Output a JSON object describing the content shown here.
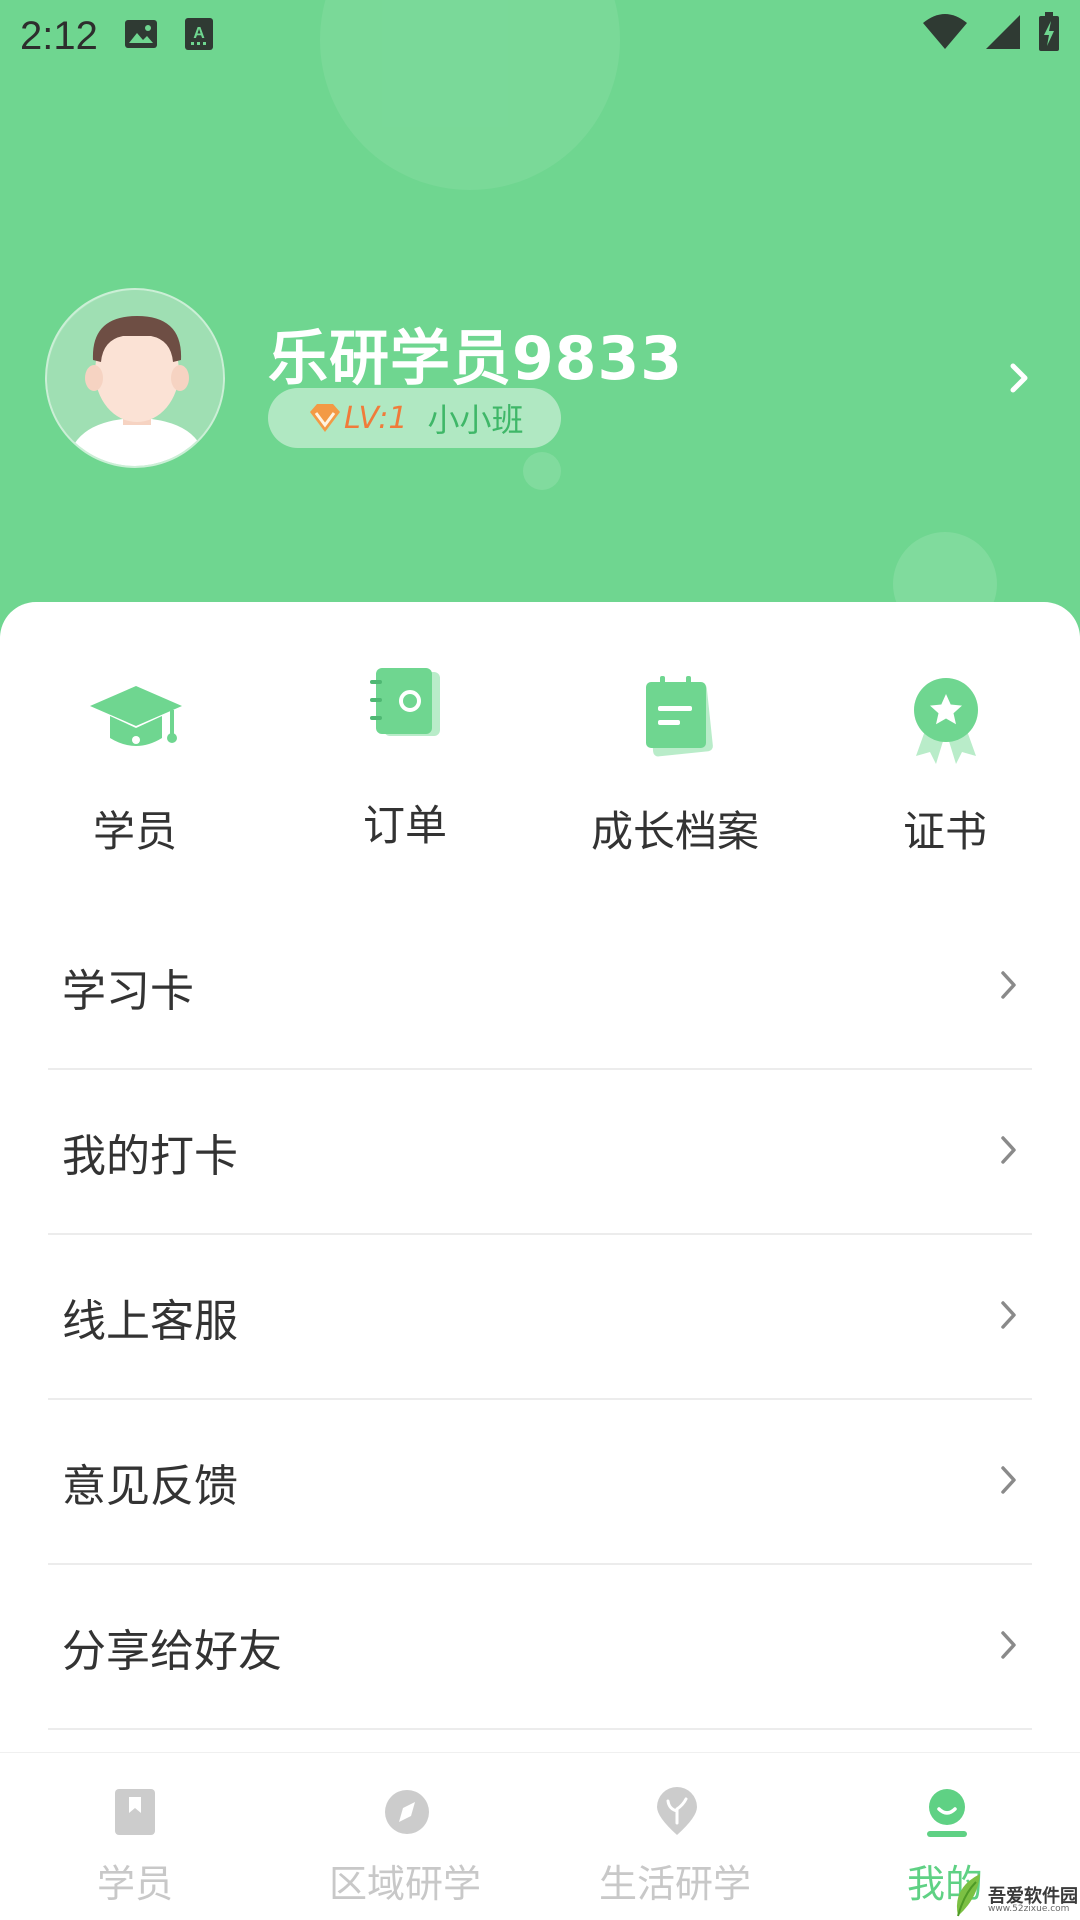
{
  "status_bar": {
    "time": "2:12"
  },
  "profile": {
    "username": "乐研学员9833",
    "level": "LV:1",
    "class_name": "小小班"
  },
  "quick_actions": [
    {
      "label": "学员",
      "icon": "graduation-cap-icon"
    },
    {
      "label": "订单",
      "icon": "notebook-icon"
    },
    {
      "label": "成长档案",
      "icon": "notepad-icon"
    },
    {
      "label": "证书",
      "icon": "award-badge-icon"
    }
  ],
  "menu": [
    {
      "label": "学习卡"
    },
    {
      "label": "我的打卡"
    },
    {
      "label": "线上客服"
    },
    {
      "label": "意见反馈"
    },
    {
      "label": "分享给好友"
    }
  ],
  "bottom_nav": [
    {
      "label": "学员",
      "icon": "bookmark-icon",
      "active": false
    },
    {
      "label": "区域研学",
      "icon": "compass-icon",
      "active": false
    },
    {
      "label": "生活研学",
      "icon": "sprout-icon",
      "active": false
    },
    {
      "label": "我的",
      "icon": "user-icon",
      "active": true
    }
  ],
  "watermark": {
    "text": "吾爱软件园",
    "url": "www.52zixue.com"
  },
  "colors": {
    "primary": "#6fd690",
    "accent_green": "#5fd184",
    "level_orange": "#f07b3a"
  }
}
